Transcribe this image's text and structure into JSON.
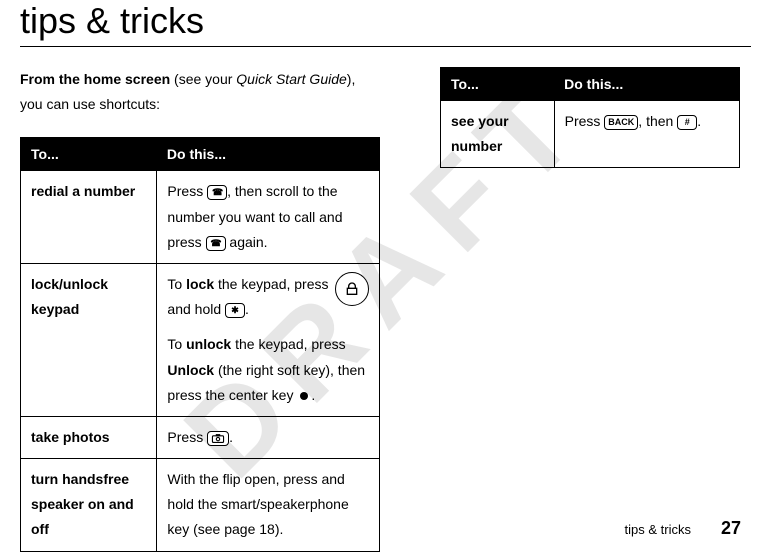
{
  "watermark": "DRAFT",
  "title": "tips & tricks",
  "intro": {
    "bold_lead": "From the home screen",
    "middle": " (see your ",
    "italic": "Quick Start Guide",
    "end": "), you can use shortcuts:"
  },
  "table_headers": {
    "to": "To...",
    "do": "Do this..."
  },
  "left_rows": [
    {
      "to": "redial a number",
      "do_parts": {
        "a": "Press ",
        "b": ", then scroll to the number you want to call and press ",
        "c": " again."
      }
    },
    {
      "to": "lock/unlock keypad",
      "do_parts": {
        "p1a": "To ",
        "p1b": "lock",
        "p1c": " the keypad, press and hold ",
        "p1d": ".",
        "p2a": "To ",
        "p2b": "unlock",
        "p2c": " the keypad, press ",
        "p2d": "Unlock",
        "p2e": " (the right soft key), then press the center key ",
        "p2f": "."
      }
    },
    {
      "to": "take photos",
      "do_parts": {
        "a": "Press ",
        "b": "."
      }
    },
    {
      "to": "turn handsfree speaker on and off",
      "do_parts": {
        "a": "With the flip open, press and hold the smart/speakerphone key (see page 18)."
      }
    }
  ],
  "right_rows": [
    {
      "to": "see your number",
      "do_parts": {
        "a": "Press ",
        "b": ", then ",
        "c": "."
      }
    }
  ],
  "icons": {
    "call": "☎",
    "star": "✱",
    "back": "BACK",
    "hash": "#"
  },
  "footer": {
    "section": "tips & tricks",
    "page": "27"
  }
}
